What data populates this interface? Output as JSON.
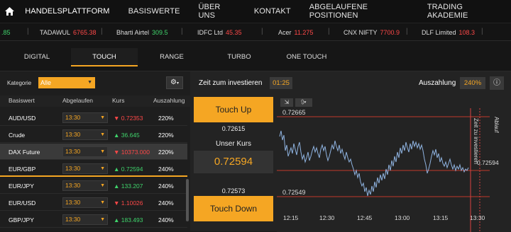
{
  "nav": {
    "items": [
      "HANDELSPLATTFORM",
      "BASISWERTE",
      "ÜBER UNS",
      "KONTAKT",
      "ABGELAUFENE POSITIONEN",
      "TRADING AKADEMIE"
    ]
  },
  "ticker": [
    {
      "name": "",
      "value": ".85",
      "dir": "up"
    },
    {
      "name": "TADAWUL",
      "value": "6765.38",
      "dir": "down"
    },
    {
      "name": "Bharti Airtel",
      "value": "309.5",
      "dir": "up"
    },
    {
      "name": "IDFC Ltd",
      "value": "45.35",
      "dir": "down"
    },
    {
      "name": "Acer",
      "value": "11.275",
      "dir": "down"
    },
    {
      "name": "CNX NIFTY",
      "value": "7700.9",
      "dir": "down"
    },
    {
      "name": "DLF Limited",
      "value": "108.3",
      "dir": "down"
    }
  ],
  "tabs": [
    "DIGITAL",
    "TOUCH",
    "RANGE",
    "TURBO",
    "ONE TOUCH"
  ],
  "active_tab": "TOUCH",
  "filter": {
    "label": "Kategorie",
    "value": "Alle"
  },
  "table": {
    "headers": [
      "Basiswert",
      "Abgelaufen",
      "Kurs",
      "Auszahlung"
    ],
    "rows": [
      {
        "name": "AUD/USD",
        "expiry": "13:30",
        "price": "0.72353",
        "dir": "down",
        "payout": "220%"
      },
      {
        "name": "Crude",
        "expiry": "13:30",
        "price": "36.645",
        "dir": "up",
        "payout": "220%"
      },
      {
        "name": "DAX Future",
        "expiry": "13:30",
        "price": "10373.000",
        "dir": "down",
        "payout": "220%"
      },
      {
        "name": "EUR/GBP",
        "expiry": "13:30",
        "price": "0.72594",
        "dir": "up",
        "payout": "240%"
      },
      {
        "name": "EUR/JPY",
        "expiry": "13:30",
        "price": "133.207",
        "dir": "up",
        "payout": "240%"
      },
      {
        "name": "EUR/USD",
        "expiry": "13:30",
        "price": "1.10026",
        "dir": "down",
        "payout": "240%"
      },
      {
        "name": "GBP/JPY",
        "expiry": "13:30",
        "price": "183.493",
        "dir": "up",
        "payout": "240%"
      }
    ]
  },
  "trade": {
    "zeit_label": "Zeit zum investieren",
    "zeit_value": "01:25",
    "auszahlung_label": "Auszahlung",
    "auszahlung_value": "240%",
    "touch_up": "Touch Up",
    "upper_price": "0.72615",
    "unser_kurs_label": "Unser Kurs",
    "unser_kurs_value": "0.72594",
    "lower_price": "0.72573",
    "touch_down": "Touch Down"
  },
  "chart": {
    "upper_label": "0.72665",
    "lower_label": "0.72549",
    "current_label": "0.72594",
    "vertical_label_1": "Zeit zu investieren",
    "vertical_label_2": "Ablauf",
    "x_ticks": [
      "12:15",
      "12:30",
      "12:45",
      "13:00",
      "13:15",
      "13:30"
    ]
  },
  "colors": {
    "accent": "#f5a623",
    "up": "#3fd36b",
    "down": "#ff4848",
    "chart_line": "#8fb3e0"
  }
}
